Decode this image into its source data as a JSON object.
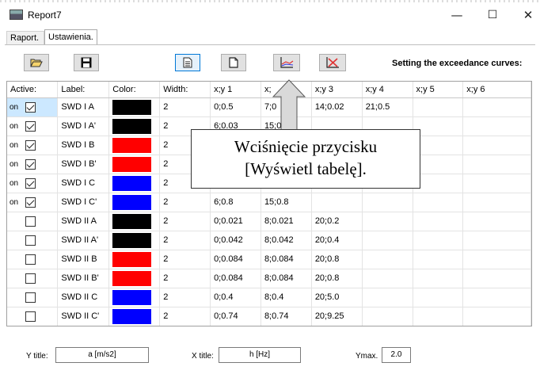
{
  "window": {
    "title": "Report7",
    "minimize": "—",
    "maximize": "☐",
    "close": "✕"
  },
  "tabs": [
    {
      "label": "Raport.",
      "active": false
    },
    {
      "label": "Ustawienia.",
      "active": true
    }
  ],
  "toolbar": {
    "buttons": [
      {
        "name": "open-folder-button",
        "icon": "folder-open-icon",
        "glyph": "📂"
      },
      {
        "name": "save-button",
        "icon": "floppy-disk-icon",
        "glyph": "💾"
      },
      {
        "name": "show-table-button",
        "icon": "table-document-icon",
        "glyph": "🗎",
        "highlighted": true
      },
      {
        "name": "new-document-button",
        "icon": "blank-document-icon",
        "glyph": "🗋"
      },
      {
        "name": "add-curve-button",
        "icon": "chart-curve-icon",
        "glyph": ""
      },
      {
        "name": "delete-curve-button",
        "icon": "chart-delete-icon",
        "glyph": ""
      }
    ],
    "setting_label": "Setting the exceedance curves:"
  },
  "grid": {
    "columns": [
      "Active:",
      "Label:",
      "Color:",
      "Width:",
      "x;y 1",
      "x;y 2",
      "x;y 3",
      "x;y 4",
      "x;y 5",
      "x;y 6"
    ],
    "header_x2_visible": "x;",
    "rows": [
      {
        "on": "on",
        "checked": true,
        "label": "SWD I A",
        "color": "#000000",
        "width": "2",
        "xy1": "0;0.5",
        "xy2": "7;0",
        "xy3": "14;0.02",
        "xy4": "21;0.5",
        "xy5": "",
        "xy6": "",
        "selected": true
      },
      {
        "on": "on",
        "checked": true,
        "label": "SWD I A'",
        "color": "#000000",
        "width": "2",
        "xy1": "6;0.03",
        "xy2": "15;0.03",
        "xy3": "",
        "xy4": "",
        "xy5": "",
        "xy6": ""
      },
      {
        "on": "on",
        "checked": true,
        "label": "SWD I B",
        "color": "#ff0000",
        "width": "2",
        "xy1": "",
        "xy2": "",
        "xy3": "",
        "xy4": "",
        "xy5": "",
        "xy6": ""
      },
      {
        "on": "on",
        "checked": true,
        "label": "SWD I B'",
        "color": "#ff0000",
        "width": "2",
        "xy1": "",
        "xy2": "",
        "xy3": "",
        "xy4": "",
        "xy5": "",
        "xy6": ""
      },
      {
        "on": "on",
        "checked": true,
        "label": "SWD I C",
        "color": "#0000ff",
        "width": "2",
        "xy1": "",
        "xy2": "",
        "xy3": "",
        "xy4": "",
        "xy5": "",
        "xy6": ""
      },
      {
        "on": "on",
        "checked": true,
        "label": "SWD I C'",
        "color": "#0000ff",
        "width": "2",
        "xy1": "6;0.8",
        "xy2": "15;0.8",
        "xy3": "",
        "xy4": "",
        "xy5": "",
        "xy6": ""
      },
      {
        "on": "",
        "checked": false,
        "label": "SWD II A",
        "color": "#000000",
        "width": "2",
        "xy1": "0;0.021",
        "xy2": "8;0.021",
        "xy3": "20;0.2",
        "xy4": "",
        "xy5": "",
        "xy6": ""
      },
      {
        "on": "",
        "checked": false,
        "label": "SWD II A'",
        "color": "#000000",
        "width": "2",
        "xy1": "0;0.042",
        "xy2": "8;0.042",
        "xy3": "20;0.4",
        "xy4": "",
        "xy5": "",
        "xy6": ""
      },
      {
        "on": "",
        "checked": false,
        "label": "SWD II B",
        "color": "#ff0000",
        "width": "2",
        "xy1": "0;0.084",
        "xy2": "8;0.084",
        "xy3": "20;0.8",
        "xy4": "",
        "xy5": "",
        "xy6": ""
      },
      {
        "on": "",
        "checked": false,
        "label": "SWD II B'",
        "color": "#ff0000",
        "width": "2",
        "xy1": "0;0.084",
        "xy2": "8;0.084",
        "xy3": "20;0.8",
        "xy4": "",
        "xy5": "",
        "xy6": ""
      },
      {
        "on": "",
        "checked": false,
        "label": "SWD II C",
        "color": "#0000ff",
        "width": "2",
        "xy1": "0;0.4",
        "xy2": "8;0.4",
        "xy3": "20;5.0",
        "xy4": "",
        "xy5": "",
        "xy6": ""
      },
      {
        "on": "",
        "checked": false,
        "label": "SWD II C'",
        "color": "#0000ff",
        "width": "2",
        "xy1": "0;0.74",
        "xy2": "8;0.74",
        "xy3": "20;9.25",
        "xy4": "",
        "xy5": "",
        "xy6": ""
      }
    ]
  },
  "callout": {
    "line1": "Wciśnięcie przycisku",
    "line2": "[Wyświetl tabelę]."
  },
  "bottom": {
    "y_title_label": "Y title:",
    "y_title_value": "a [m/s2]",
    "x_title_label": "X title:",
    "x_title_value": "h [Hz]",
    "ymax_label": "Ymax.",
    "ymax_value": "2.0"
  }
}
